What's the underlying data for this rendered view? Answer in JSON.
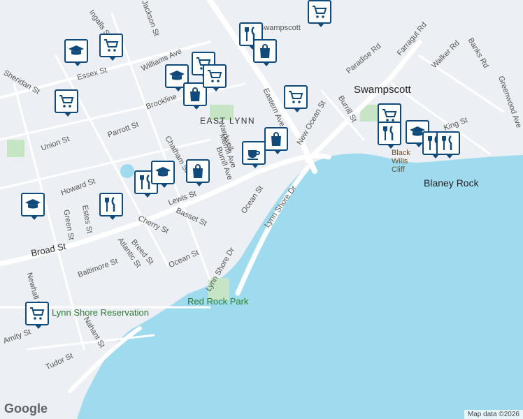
{
  "colors": {
    "water": "#9fdbef",
    "land": "#eceff3",
    "road": "#ffffff",
    "park": "#c5e5c4",
    "pin": "#0e4a7c"
  },
  "labels": {
    "swampscott": "Swampscott",
    "east_lynn": "EAST LYNN",
    "blaney_rock": "Blaney Rock",
    "black_wills_cliff": "Black Wills Cliff",
    "red_rock_park": "Red Rock Park",
    "lynn_shore_reservation": "Lynn Shore Reservation"
  },
  "streets": [
    {
      "name": "Ingalls St"
    },
    {
      "name": "Jackson St"
    },
    {
      "name": "Essex St"
    },
    {
      "name": "Sheridan St"
    },
    {
      "name": "Williams Ave"
    },
    {
      "name": "Brookline"
    },
    {
      "name": "Parrott St"
    },
    {
      "name": "Union St"
    },
    {
      "name": "Howard St"
    },
    {
      "name": "Lewis St"
    },
    {
      "name": "Chatham St"
    },
    {
      "name": "Basset St"
    },
    {
      "name": "Cherry St"
    },
    {
      "name": "Green St"
    },
    {
      "name": "Estes St"
    },
    {
      "name": "Broad St"
    },
    {
      "name": "Breed St"
    },
    {
      "name": "Atlantic St"
    },
    {
      "name": "Baltimore St"
    },
    {
      "name": "Ocean St"
    },
    {
      "name": "Lynn Shore Dr"
    },
    {
      "name": "Eastern Ave"
    },
    {
      "name": "New Ocean St"
    },
    {
      "name": "Burrill St"
    },
    {
      "name": "Paradise Rd"
    },
    {
      "name": "Farragut Rd"
    },
    {
      "name": "Walker Rd"
    },
    {
      "name": "Banks Rd"
    },
    {
      "name": "Greenwood Ave"
    },
    {
      "name": "King St"
    },
    {
      "name": "Nahant St"
    },
    {
      "name": "Amity St"
    },
    {
      "name": "Tudor St"
    },
    {
      "name": "Newhall St"
    },
    {
      "name": "Wardwell"
    },
    {
      "name": "Merrill Ave"
    },
    {
      "name": "Burrill Ave"
    },
    {
      "name": "Swampscott"
    }
  ],
  "pins": [
    {
      "type": "shopping-cart"
    },
    {
      "type": "school"
    },
    {
      "type": "restaurant"
    },
    {
      "type": "shopping-bag"
    },
    {
      "type": "shopping-cart"
    },
    {
      "type": "school"
    },
    {
      "type": "shopping-cart"
    },
    {
      "type": "shopping-bag"
    },
    {
      "type": "shopping-cart"
    },
    {
      "type": "shopping-cart"
    },
    {
      "type": "cafe"
    },
    {
      "type": "shopping-bag"
    },
    {
      "type": "shopping-cart"
    },
    {
      "type": "shopping-bag"
    },
    {
      "type": "restaurant"
    },
    {
      "type": "school"
    },
    {
      "type": "school"
    },
    {
      "type": "restaurant"
    },
    {
      "type": "shopping-cart"
    },
    {
      "type": "restaurant"
    },
    {
      "type": "school"
    },
    {
      "type": "restaurant"
    },
    {
      "type": "restaurant"
    },
    {
      "type": "shopping-cart"
    }
  ],
  "branding": {
    "logo": "Google",
    "attribution": "Map data ©2026"
  }
}
